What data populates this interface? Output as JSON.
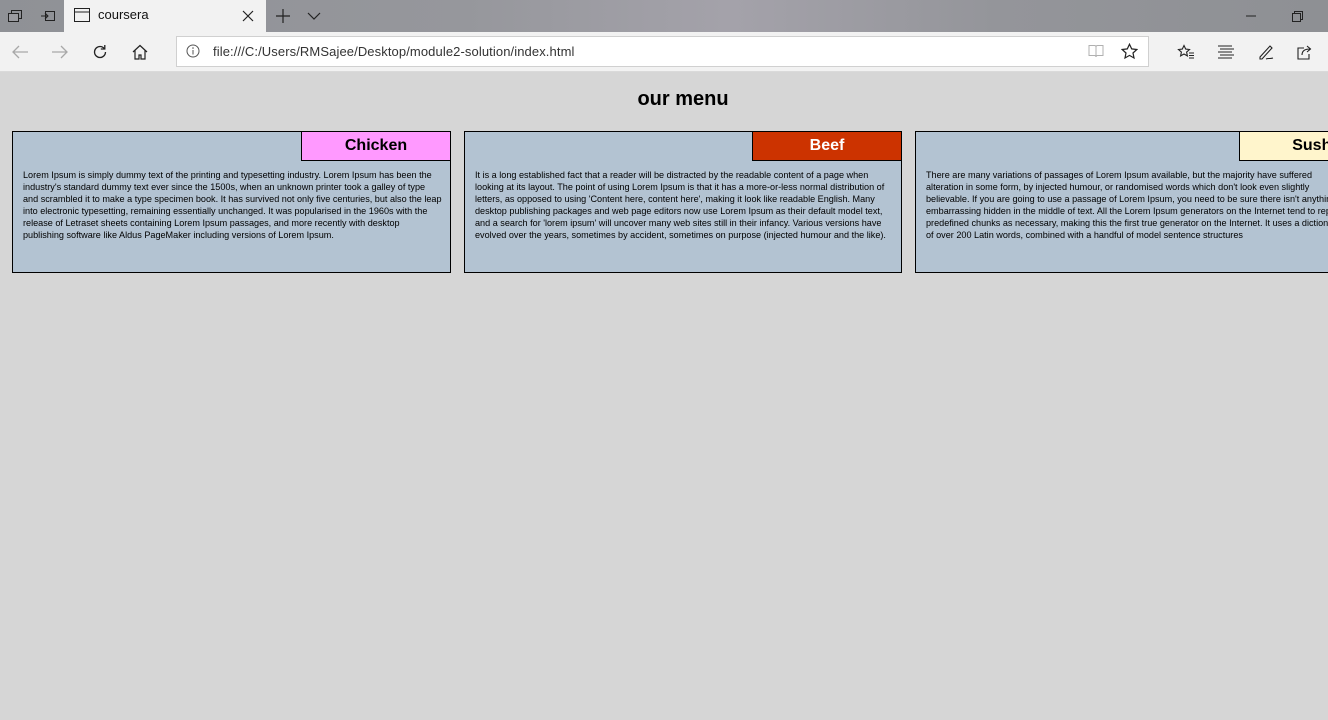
{
  "browser": {
    "tab_title": "coursera",
    "url": "file:///C:/Users/RMSajee/Desktop/module2-solution/index.html"
  },
  "page": {
    "heading": "our menu",
    "items": [
      {
        "name": "Chicken",
        "color": "#ff99ff",
        "text_color": "#000000",
        "text": "Lorem Ipsum is simply dummy text of the printing and typesetting industry. Lorem Ipsum has been the industry's standard dummy text ever since the 1500s, when an unknown printer took a galley of type and scrambled it to make a type specimen book. It has survived not only five centuries, but also the leap into electronic typesetting, remaining essentially unchanged. It was popularised in the 1960s with the release of Letraset sheets containing Lorem Ipsum passages, and more recently with desktop publishing software like Aldus PageMaker including versions of Lorem Ipsum."
      },
      {
        "name": "Beef",
        "color": "#cc3300",
        "text_color": "#ffffff",
        "text": "It is a long established fact that a reader will be distracted by the readable content of a page when looking at its layout. The point of using Lorem Ipsum is that it has a more-or-less normal distribution of letters, as opposed to using 'Content here, content here', making it look like readable English. Many desktop publishing packages and web page editors now use Lorem Ipsum as their default model text, and a search for 'lorem ipsum' will uncover many web sites still in their infancy. Various versions have evolved over the years, sometimes by accident, sometimes on purpose (injected humour and the like)."
      },
      {
        "name": "Sushi",
        "color": "#fff5cc",
        "text_color": "#000000",
        "text": "There are many variations of passages of Lorem Ipsum available, but the majority have suffered alteration in some form, by injected humour, or randomised words which don't look even slightly believable. If you are going to use a passage of Lorem Ipsum, you need to be sure there isn't anything embarrassing hidden in the middle of text. All the Lorem Ipsum generators on the Internet tend to repeat predefined chunks as necessary, making this the first true generator on the Internet. It uses a dictionary of over 200 Latin words, combined with a handful of model sentence structures"
      }
    ]
  },
  "icons": {
    "tab_tray": "tab-tray-icon",
    "set_aside": "set-aside-tabs-icon",
    "page": "page-icon",
    "close": "close-icon",
    "new_tab": "plus-icon",
    "tab_list": "chevron-down-icon",
    "minimize": "minimize-icon",
    "restore": "restore-icon",
    "back": "back-arrow-icon",
    "forward": "forward-arrow-icon",
    "refresh": "refresh-icon",
    "home": "home-icon",
    "site_info": "info-icon",
    "reading_view": "book-icon",
    "favorite": "star-icon",
    "favorites": "favorites-icon",
    "hub": "hub-icon",
    "notes": "pen-icon",
    "share": "share-icon"
  }
}
